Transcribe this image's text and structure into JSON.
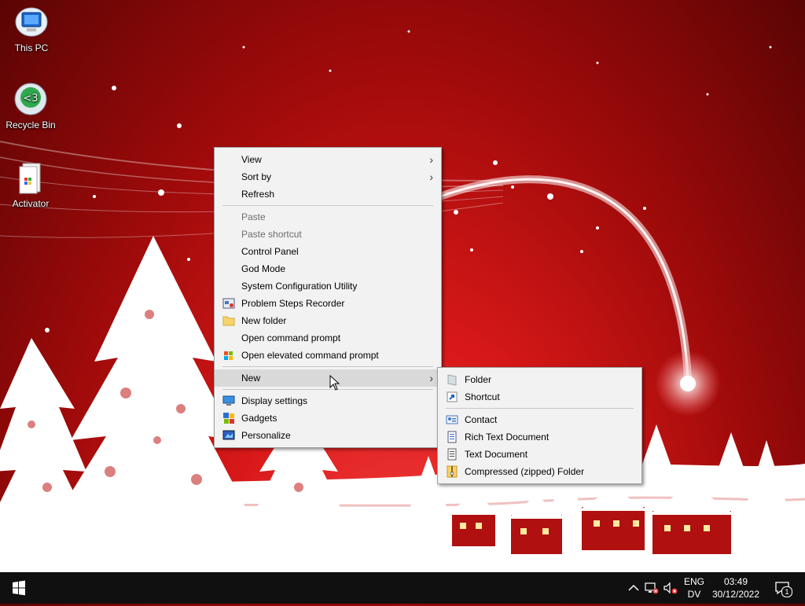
{
  "desktop": {
    "icons": [
      {
        "label": "This PC"
      },
      {
        "label": "Recycle Bin"
      },
      {
        "label": "Activator"
      }
    ]
  },
  "context_menu": {
    "items": [
      {
        "label": "View",
        "submenu": true
      },
      {
        "label": "Sort by",
        "submenu": true
      },
      {
        "label": "Refresh"
      },
      {
        "label": "Paste",
        "disabled": true
      },
      {
        "label": "Paste shortcut",
        "disabled": true
      },
      {
        "label": "Control Panel"
      },
      {
        "label": "God Mode"
      },
      {
        "label": "System Configuration Utility"
      },
      {
        "label": "Problem Steps Recorder",
        "icon": "steps-recorder-icon"
      },
      {
        "label": "New folder",
        "icon": "folder-icon"
      },
      {
        "label": "Open command prompt"
      },
      {
        "label": "Open elevated command prompt",
        "icon": "windows-shield-icon"
      },
      {
        "label": "New",
        "submenu": true,
        "highlighted": true
      },
      {
        "label": "Display settings",
        "icon": "display-icon"
      },
      {
        "label": "Gadgets",
        "icon": "gadgets-icon"
      },
      {
        "label": "Personalize",
        "icon": "personalize-icon"
      }
    ]
  },
  "new_submenu": {
    "items": [
      {
        "label": "Folder",
        "icon": "folder-icon"
      },
      {
        "label": "Shortcut",
        "icon": "shortcut-icon"
      },
      {
        "label": "Contact",
        "icon": "contact-card-icon"
      },
      {
        "label": "Rich Text Document",
        "icon": "rich-text-icon"
      },
      {
        "label": "Text Document",
        "icon": "text-document-icon"
      },
      {
        "label": "Compressed (zipped) Folder",
        "icon": "zip-folder-icon"
      }
    ]
  },
  "taskbar": {
    "lang_line1": "ENG",
    "lang_line2": "DV",
    "time": "03:49",
    "date": "30/12/2022",
    "notification_count": "1"
  },
  "colors": {
    "menu_background": "#f2f2f2",
    "menu_hover": "#d9d9d9",
    "taskbar": "#101010",
    "wallpaper_red": "#d81818"
  }
}
